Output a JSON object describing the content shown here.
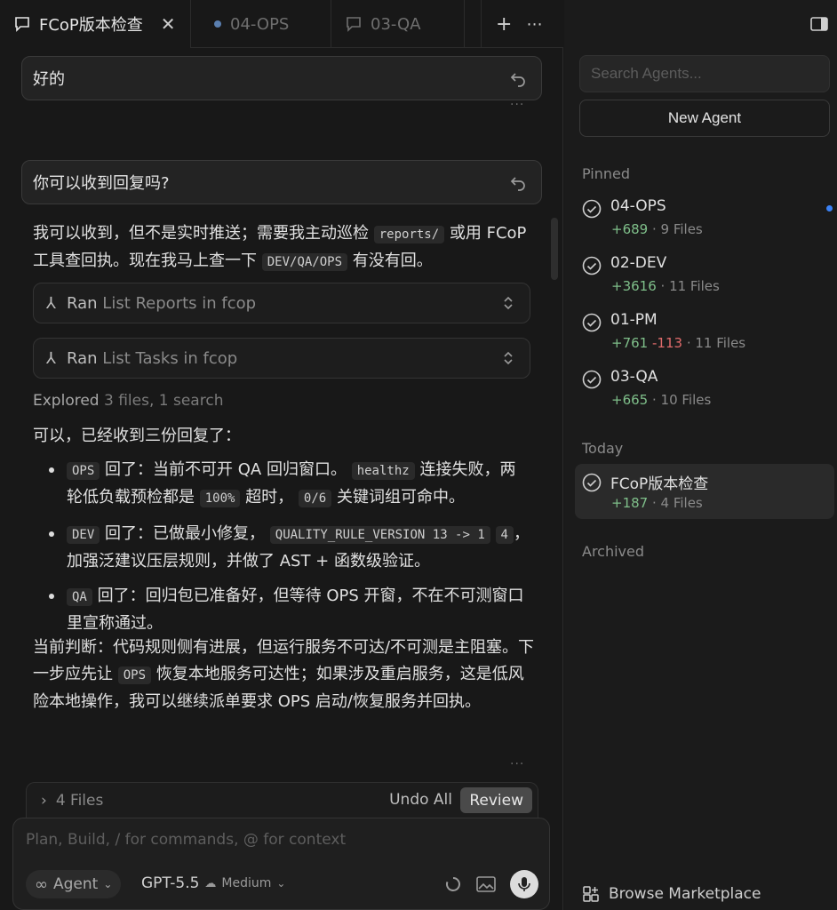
{
  "tabs": [
    {
      "label": "FCoP版本检查",
      "active": true
    },
    {
      "label": "04-OPS",
      "active": false
    },
    {
      "label": "03-QA",
      "active": false
    }
  ],
  "messages": {
    "user1": "好的",
    "user2": "你可以收到回复吗?"
  },
  "reply": {
    "p1_a": "我可以收到，但不是实时推送；需要我主动巡检",
    "p1_code1": "reports/",
    "p1_b": "或用 FCoP 工具查回执。现在我马上查一下",
    "p1_code2": "DEV/QA/OPS",
    "p1_c": "有没有回。",
    "tool1": {
      "verb": "Ran",
      "text": "List Reports in fcop"
    },
    "tool2": {
      "verb": "Ran",
      "text": "List Tasks in fcop"
    },
    "explored_verb": "Explored",
    "explored_text": "3 files, 1 search",
    "intro": "可以，已经收到三份回复了：",
    "bullets": [
      {
        "code": "OPS",
        "a": "回了：当前不可开 QA 回归窗口。",
        "code2": "healthz",
        "b": "连接失败，两轮低负载预检都是",
        "code3": "100%",
        "c": "超时，",
        "code4": "0/6",
        "d": "关键词组可命中。"
      },
      {
        "code": "DEV",
        "a": "回了：已做最小修复，",
        "code2": "QUALITY_RULE_VERSION 13 -> 1",
        "code2b": "4",
        "b": "，加强泛建议压层规则，并做了 AST + 函数级验证。"
      },
      {
        "code": "QA",
        "a": "回了：回归包已准备好，但等待 OPS 开窗，不在不可测窗口里宣称通过。"
      }
    ],
    "summary_a": "当前判断：代码规则侧有进展，但运行服务不可达/不可测是主阻塞。下一步应先让",
    "summary_code": "OPS",
    "summary_b": "恢复本地服务可达性；如果涉及重启服务，这是低风险本地操作，我可以继续派单要求 OPS 启动/恢复服务并回执。"
  },
  "files_bar": {
    "label": "4 Files",
    "undo_all": "Undo All",
    "review": "Review"
  },
  "composer": {
    "placeholder": "Plan, Build, / for commands, @ for context",
    "mode": "Agent",
    "model": "GPT-5.5",
    "effort": "Medium"
  },
  "sidebar": {
    "search_placeholder": "Search Agents...",
    "new_agent": "New Agent",
    "pinned_label": "Pinned",
    "today_label": "Today",
    "archived_label": "Archived",
    "pinned": [
      {
        "name": "04-OPS",
        "add": "+689",
        "del": "",
        "files": "· 9 Files",
        "unread": true
      },
      {
        "name": "02-DEV",
        "add": "+3616",
        "del": "",
        "files": "· 11 Files",
        "unread": false
      },
      {
        "name": "01-PM",
        "add": "+761",
        "del": "-113",
        "files": "· 11 Files",
        "unread": false
      },
      {
        "name": "03-QA",
        "add": "+665",
        "del": "",
        "files": "· 10 Files",
        "unread": false
      }
    ],
    "today": [
      {
        "name": "FCoP版本检查",
        "add": "+187",
        "del": "",
        "files": "· 4 Files"
      }
    ],
    "marketplace": "Browse Marketplace"
  },
  "colors": {
    "accent_blue": "#3b82f6",
    "add_green": "#7fbf8a",
    "del_red": "#e06b6b"
  }
}
